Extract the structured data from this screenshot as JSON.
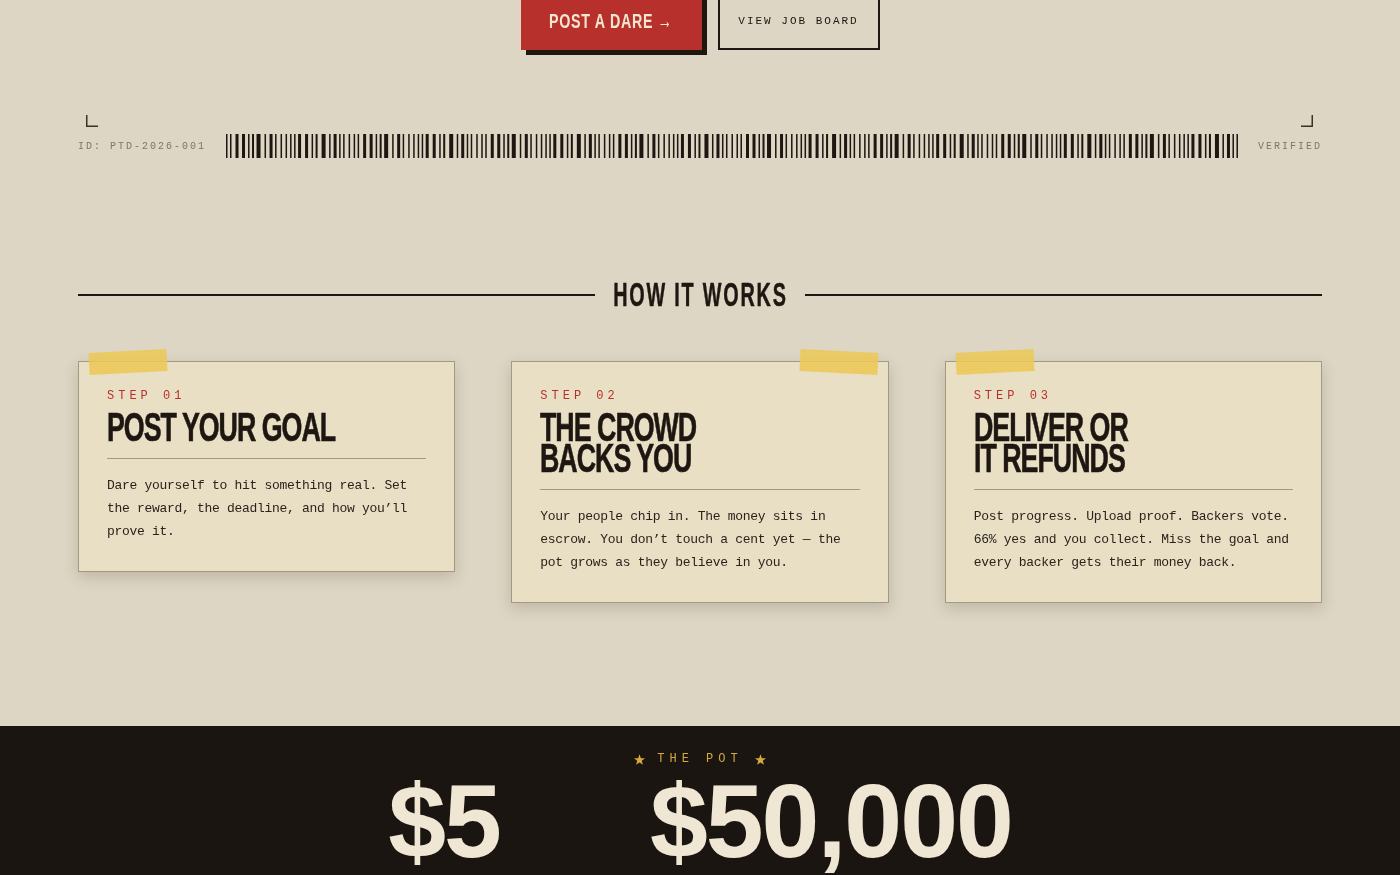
{
  "hero_actions": [
    {
      "label": "POST A DARE →",
      "kind": "primary"
    },
    {
      "label": "VIEW JOB BOARD",
      "kind": "secondary"
    }
  ],
  "ticket": {
    "id": "ID: PTD-2026-001",
    "status": "VERIFIED"
  },
  "how_it_works": {
    "title": "HOW IT WORKS",
    "steps": [
      {
        "step": "STEP 01",
        "title": "POST YOUR GOAL",
        "text": "Dare yourself to hit something real. Set the reward, the deadline, and how you’ll prove it.",
        "tape_right": false
      },
      {
        "step": "STEP 02",
        "title": "THE CROWD\nBACKS YOU",
        "text": "Your people chip in. The money sits in escrow. You don’t touch a cent yet — the pot grows as they believe in you.",
        "tape_right": true
      },
      {
        "step": "STEP 03",
        "title": "DELIVER OR\nIT REFUNDS",
        "text": "Post progress. Upload proof. Backers vote. 66% yes and you collect. Miss the goal and every backer gets their money back.",
        "tape_right": false
      }
    ]
  },
  "pot": {
    "label": "THE POT",
    "amounts": [
      "$5",
      "$50,000"
    ]
  }
}
